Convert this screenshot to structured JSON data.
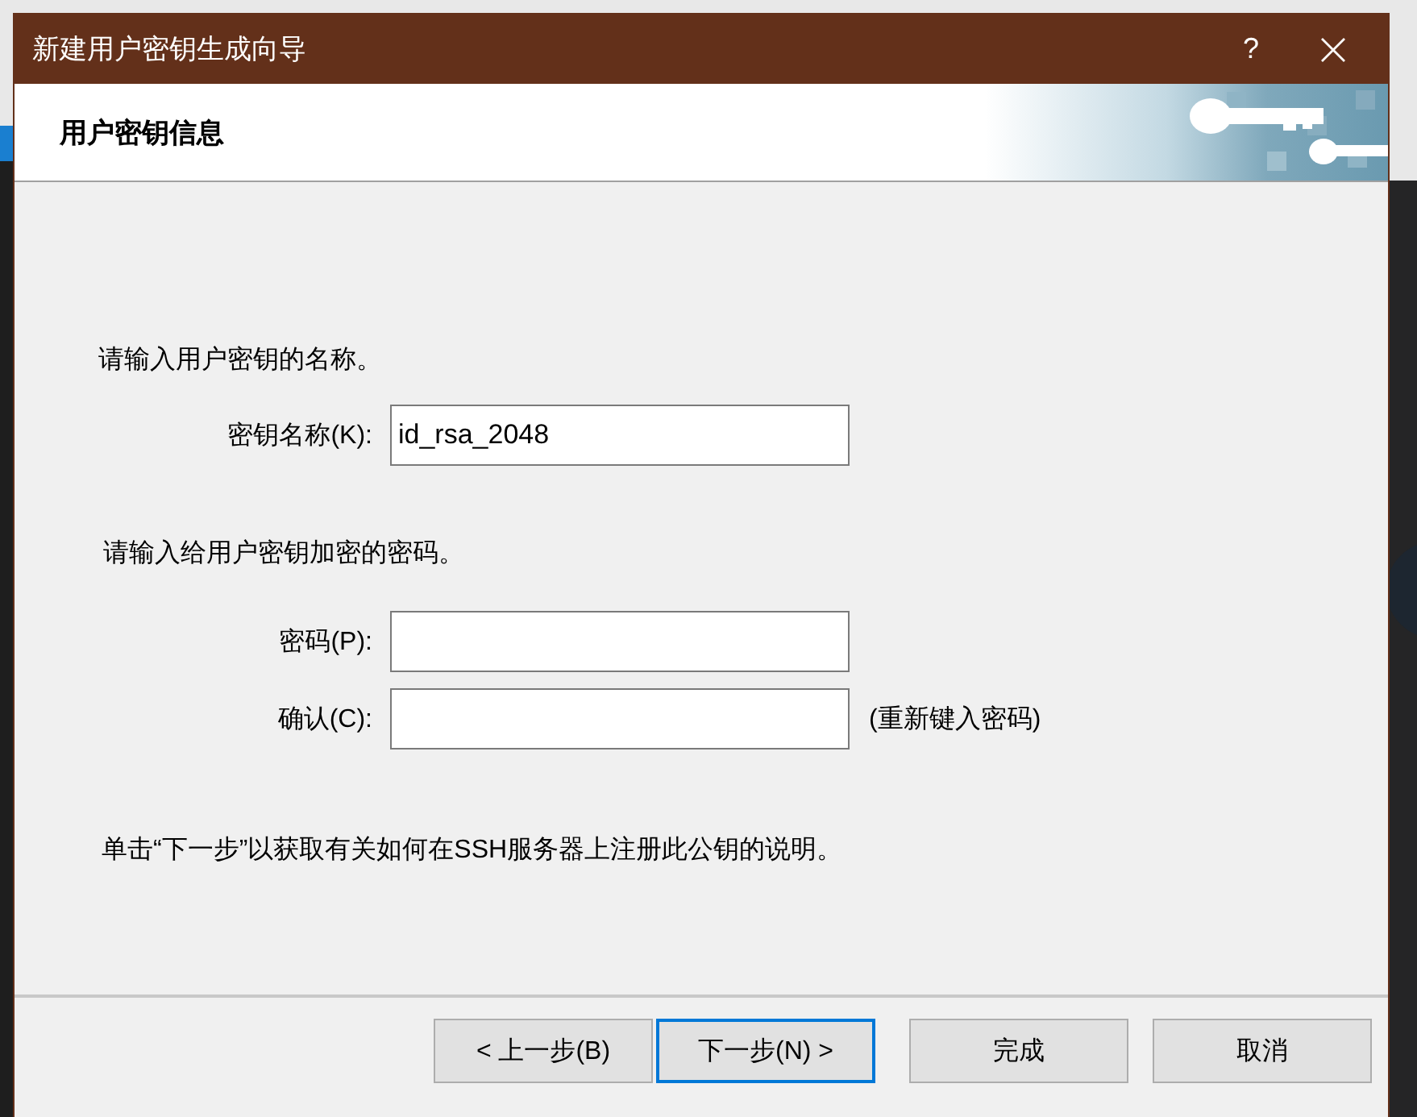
{
  "window": {
    "title": "新建用户密钥生成向导",
    "help_button": "?"
  },
  "header": {
    "title": "用户密钥信息"
  },
  "name_prompt": "请输入用户密钥的名称。",
  "key_name": {
    "label": "密钥名称(K):",
    "value": "id_rsa_2048"
  },
  "password_prompt": "请输入给用户密钥加密的密码。",
  "password": {
    "label": "密码(P):"
  },
  "confirm": {
    "label": "确认(C):",
    "hint": "(重新键入密码)"
  },
  "note": "单击“下一步”以获取有关如何在SSH服务器上注册此公钥的说明。",
  "buttons": [
    {
      "label": "< 上一步(B)",
      "focused": false
    },
    {
      "label": "下一步(N) >",
      "focused": true
    },
    {
      "label": "完成",
      "focused": false
    },
    {
      "label": "取消",
      "focused": false
    }
  ]
}
